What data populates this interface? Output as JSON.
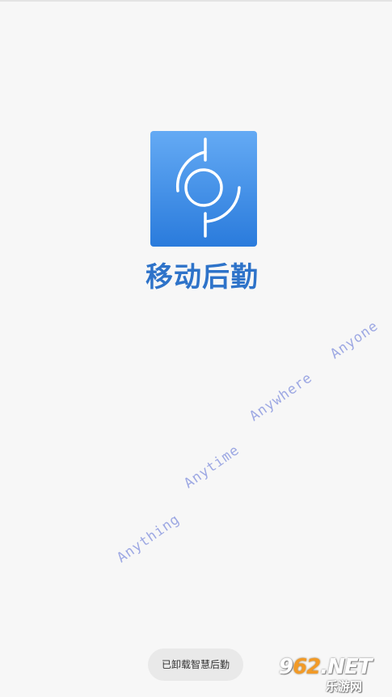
{
  "app": {
    "name": "移动后勤",
    "icon": "circle-arc-logo-icon",
    "icon_color_top": "#64aaf4",
    "icon_color_bottom": "#2a7bdc",
    "name_color": "#2e73c9"
  },
  "slogans": [
    "Anything",
    "Anytime",
    "Anywhere",
    "Anyone"
  ],
  "slogan_color": "#9da8e3",
  "toast": {
    "text": "已卸载智慧后勤"
  },
  "watermark": {
    "top_left": "9",
    "top_orange": "62",
    "top_right": ".NET",
    "bottom": "乐游网"
  }
}
